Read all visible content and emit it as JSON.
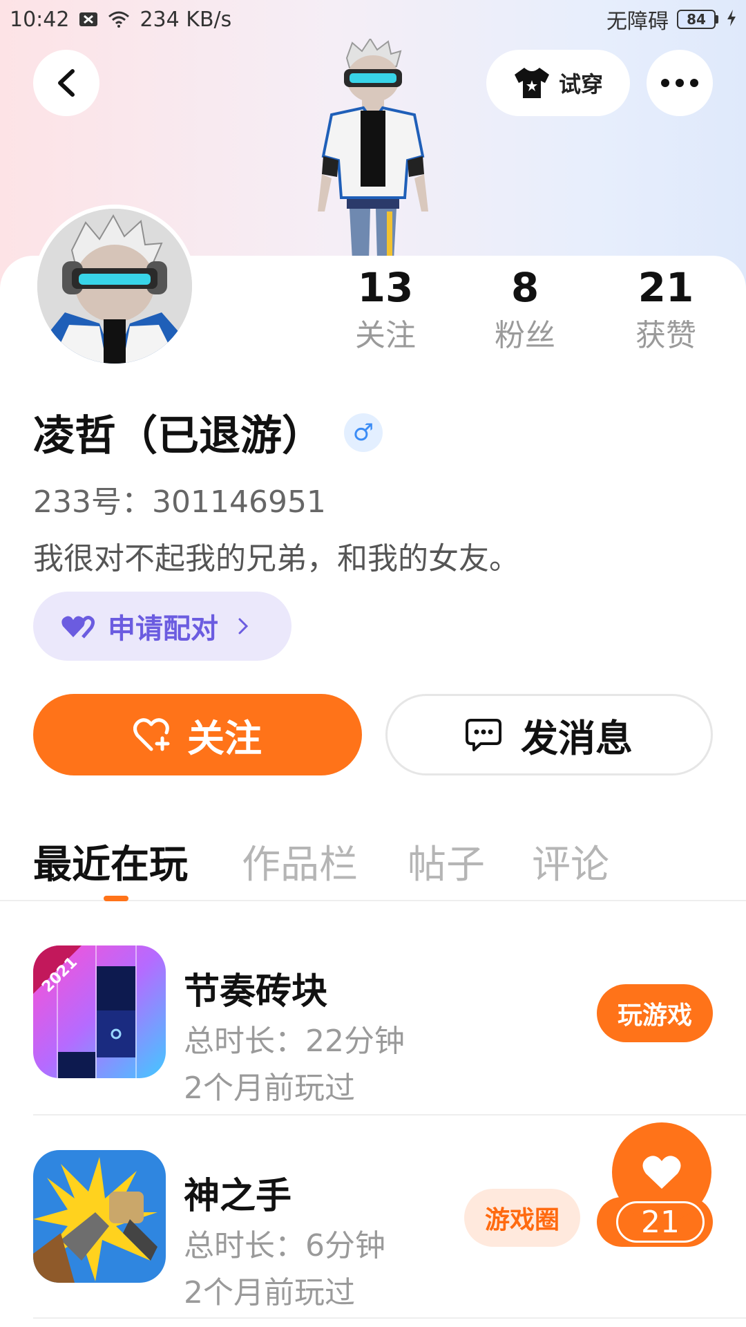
{
  "status_bar": {
    "time": "10:42",
    "net_speed": "234 KB/s",
    "accessibility": "无障碍",
    "battery": "84"
  },
  "header": {
    "back_icon": "back-chevron-icon",
    "try_on_label": "试穿",
    "try_on_icon": "tshirt-icon",
    "more_icon": "more-dots-icon"
  },
  "stats": [
    {
      "value": "13",
      "label": "关注"
    },
    {
      "value": "8",
      "label": "粉丝"
    },
    {
      "value": "21",
      "label": "获赞"
    }
  ],
  "profile": {
    "name": "凌哲（已退游）",
    "gender_symbol": "♂",
    "uid": "233号：301146951",
    "bio": "我很对不起我的兄弟，和我的女友。"
  },
  "pair_button": {
    "label": "申请配对",
    "icon": "double-heart-icon"
  },
  "actions": {
    "follow_label": "关注",
    "message_label": "发消息"
  },
  "tabs": [
    "最近在玩",
    "作品栏",
    "帖子",
    "评论"
  ],
  "games": [
    {
      "title": "节奏砖块",
      "duration": "总时长：22分钟",
      "last_played": "2个月前玩过",
      "action": "玩游戏",
      "badge": "2021"
    },
    {
      "title": "神之手",
      "duration": "总时长：6分钟",
      "last_played": "2个月前玩过",
      "action": "游戏圈"
    }
  ],
  "like_button": {
    "count": "21"
  },
  "colors": {
    "accent": "#ff7319",
    "pair_bg": "#ebe8fb",
    "pair_text": "#6b5ce0",
    "gender": "#3b8cf5"
  }
}
